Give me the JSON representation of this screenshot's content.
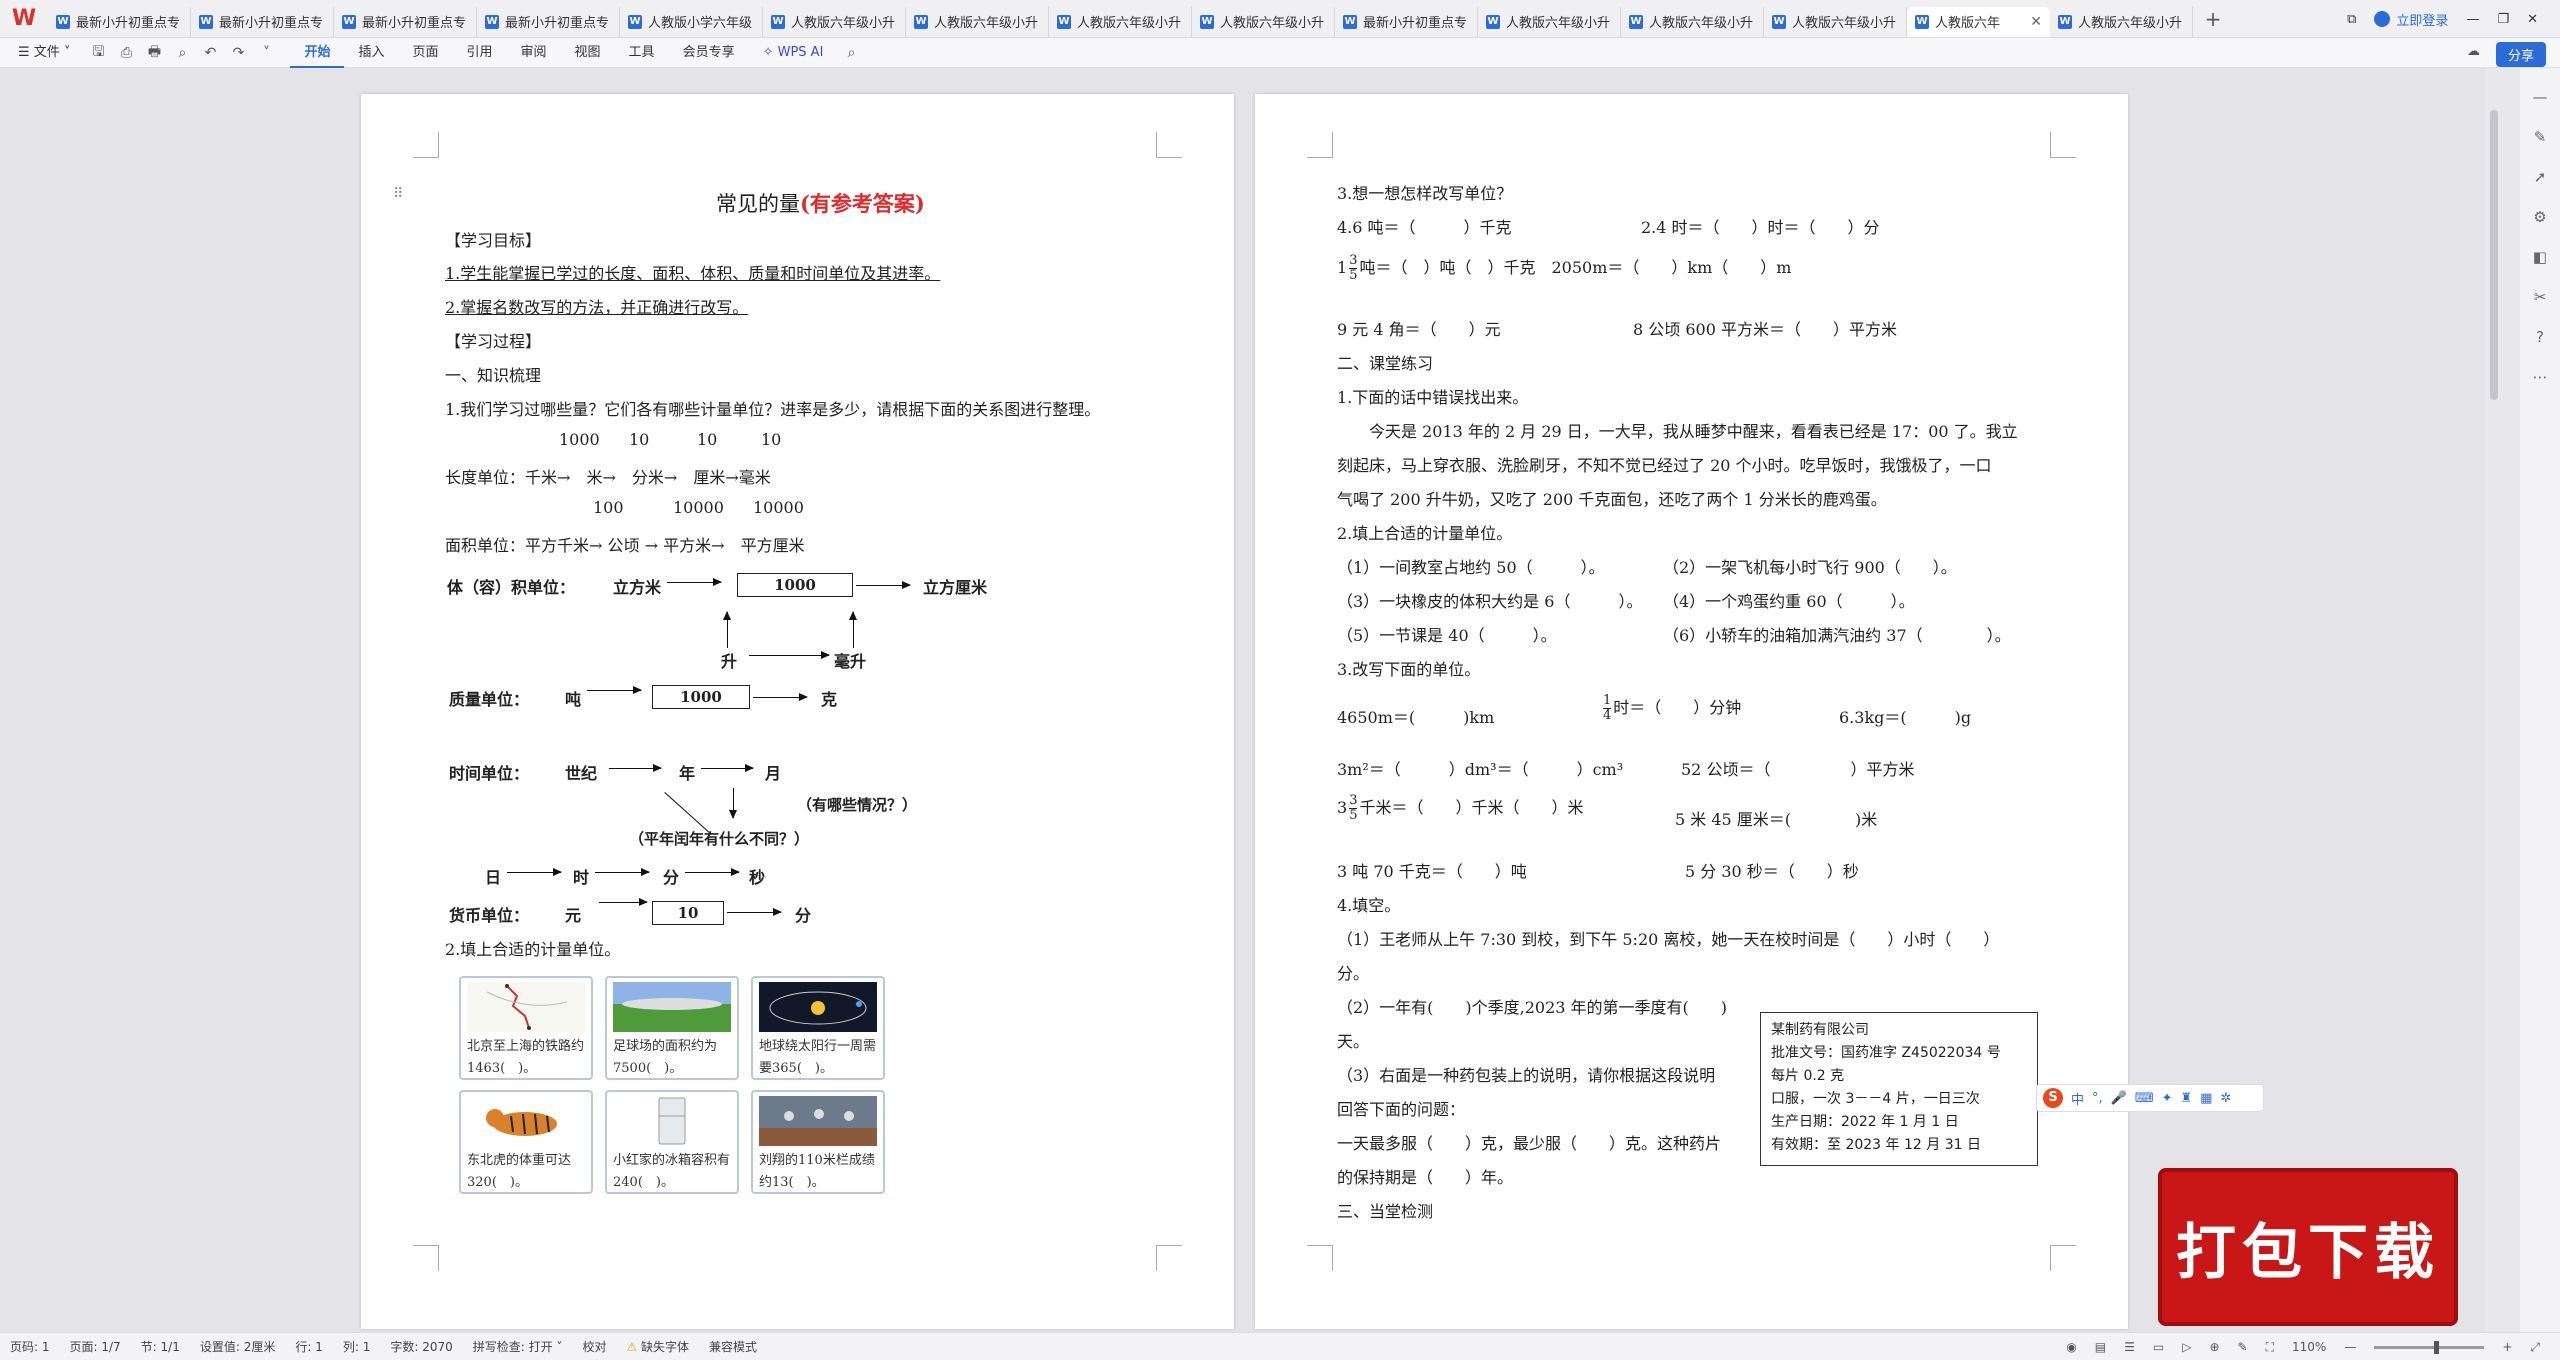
{
  "tabs": [
    {
      "label": "最新小升初重点专"
    },
    {
      "label": "最新小升初重点专"
    },
    {
      "label": "最新小升初重点专"
    },
    {
      "label": "最新小升初重点专"
    },
    {
      "label": "人教版小学六年级"
    },
    {
      "label": "人教版六年级小升"
    },
    {
      "label": "人教版六年级小升"
    },
    {
      "label": "人教版六年级小升"
    },
    {
      "label": "人教版六年级小升"
    },
    {
      "label": "最新小升初重点专"
    },
    {
      "label": "人教版六年级小升"
    },
    {
      "label": "人教版六年级小升"
    },
    {
      "label": "人教版六年级小升"
    },
    {
      "label": "人教版六年"
    },
    {
      "label": "人教版六年级小升"
    }
  ],
  "titlebar": {
    "login_label": "立即登录",
    "share_label": "分享"
  },
  "menu": {
    "file": "文件",
    "items": [
      "开始",
      "插入",
      "页面",
      "引用",
      "审阅",
      "视图",
      "工具",
      "会员专享"
    ],
    "wps_ai": "WPS AI"
  },
  "page1": {
    "title_main": "常见的量",
    "title_red": "(有参考答案)",
    "goals_heading": "【学习目标】",
    "goal1": "1.学生能掌握已学过的长度、面积、体积、质量和时间单位及其进率。",
    "goal2": "2.掌握名数改写的方法，并正确进行改写。",
    "process_heading": "【学习过程】",
    "section1": "一、知识梳理",
    "q1": "1.我们学习过哪些量？它们各有哪些计量单位？进率是多少，请根据下面的关系图进行整理。",
    "len_rates": [
      "1000",
      "10",
      "10",
      "10"
    ],
    "len_label": "长度单位：",
    "len_units": [
      "千米",
      "米",
      "分米",
      "厘米",
      "毫米"
    ],
    "area_rates": [
      "100",
      "10000",
      "10000"
    ],
    "area_label": "面积单位：",
    "area_units": [
      "平方千米",
      "公顷",
      "平方米",
      "平方厘米"
    ],
    "vol_label": "体（容）积单位：",
    "vol_from": "立方米",
    "vol_box": "1000",
    "vol_to": "立方厘米",
    "vol_sub1": "升",
    "vol_sub2": "毫升",
    "mass_label": "质量单位：",
    "mass_from": "吨",
    "mass_box": "1000",
    "mass_to": "克",
    "time_label": "时间单位：",
    "time_century": "世纪",
    "time_year": "年",
    "time_month": "月",
    "time_q1": "（有哪些情况？）",
    "time_q2": "（平年闰年有什么不同？）",
    "time_day": "日",
    "time_hour": "时",
    "time_min": "分",
    "time_sec": "秒",
    "money_label": "货币单位：",
    "money_from": "元",
    "money_box": "10",
    "money_to": "分",
    "q2": "2.填上合适的计量单位。",
    "cards": [
      {
        "text": "北京至上海的铁路约1463(　)。"
      },
      {
        "text": "足球场的面积约为7500(　)。"
      },
      {
        "text": "地球绕太阳行一周需要365(　)。"
      },
      {
        "text": "东北虎的体重可达320(　)。"
      },
      {
        "text": "小红家的冰箱容积有240(　)。"
      },
      {
        "text": "刘翔的110米栏成绩约13(　)。"
      }
    ]
  },
  "page2": {
    "q3": "3.想一想怎样改写单位？",
    "l1a": "4.6 吨＝（　　　）千克",
    "l1b": "2.4 时＝（　　）时＝（　　）分",
    "l2_whole": "1",
    "l2_num": "3",
    "l2_den": "5",
    "l2a": "吨＝（　）吨（　）千克",
    "l2b": "2050m＝（　　）km（　　）m",
    "l3a": "9 元 4 角＝（　　）元",
    "l3b": "8 公顷 600 平方米＝（　　）平方米",
    "section2": "二、课堂练习",
    "p1": "1.下面的话中错误找出来。",
    "story1": "今天是 2013 年的 2 月 29 日，一大早，我从睡梦中醒来，看看表已经是 17：00 了。我立",
    "story2": "刻起床，马上穿衣服、洗脸刷牙，不知不觉已经过了 20 个小时。吃早饭时，我饿极了，一口",
    "story3": "气喝了 200 升牛奶，又吃了 200 千克面包，还吃了两个 1 分米长的鹿鸡蛋。",
    "p2": "2.填上合适的计量单位。",
    "f1": "（1）一间教室占地约 50（　　　）。",
    "f2": "（2）一架飞机每小时飞行 900（　　）。",
    "f3": "（3）一块橡皮的体积大约是 6（　　　）。",
    "f4": "（4）一个鸡蛋约重 60（　　　）。",
    "f5": "（5）一节课是 40（　　　）。",
    "f6": "（6）小轿车的油箱加满汽油约 37（　　　　）。",
    "p3": "3.改写下面的单位。",
    "c1a": "4650m＝(　　　)km",
    "c1_num": "1",
    "c1_den": "4",
    "c1b": "时＝（　　）分钟",
    "c1c": "6.3kg＝(　　　)g",
    "c2a": "3m²＝（　　　）dm³＝（　　　）cm³",
    "c2b": "52 公顷＝（　　　　　）平方米",
    "c3_whole": "3",
    "c3_num": "3",
    "c3_den": "5",
    "c3a": "千米＝（　　）千米（　　）米",
    "c3b": "5 米 45 厘米＝(　　　　)米",
    "c4a": "3 吨 70 千克＝（　　）吨",
    "c4b": "5 分 30 秒＝（　　）秒",
    "p4": "4.填空。",
    "b1": "（1）王老师从上午 7:30 到校，到下午 5:20 离校，她一天在校时间是（　　）小时（　　）",
    "b1b": "分。",
    "b2": "（2）一年有(　　)个季度,2023 年的第一季度有(　　)",
    "b2b": "天。",
    "b3": "（3）右面是一种药包装上的说明，请你根据这段说明",
    "b3b": "回答下面的问题：",
    "b4": "一天最多服（　　）克，最少服（　　）克。这种药片",
    "b5": "的保持期是（　　）年。",
    "section3": "三、当堂检测",
    "med": {
      "company": "某制药有限公司",
      "approval": "批准文号：国药准字 Z45022034 号",
      "per_tablet": "每片 0.2 克",
      "dosage": "口服，一次 3－－4 片，一日三次",
      "prod_date": "生产日期：2022 年 1 月 1 日",
      "expiry": "有效期：至 2023 年 12 月 31 日"
    }
  },
  "ime": {
    "lang": "中"
  },
  "banner": {
    "text": "打包下载"
  },
  "status": {
    "page_no": "页码: 1",
    "page_total": "页面: 1/7",
    "section": "节: 1/1",
    "setting": "设置值: 2厘米",
    "row": "行: 1",
    "col": "列: 1",
    "words": "字数: 2070",
    "spell": "拼写检查: 打开",
    "proof": "校对",
    "missing_font": "缺失字体",
    "compat": "兼容模式",
    "zoom": "110%"
  }
}
